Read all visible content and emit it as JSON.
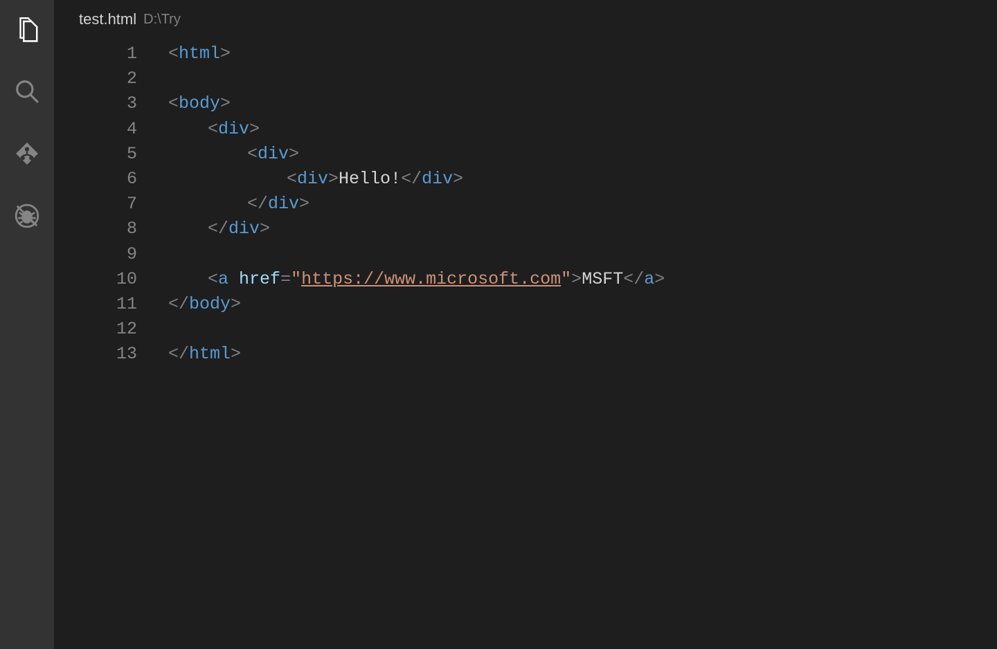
{
  "activityBar": {
    "items": [
      {
        "name": "explorer-icon",
        "active": true
      },
      {
        "name": "search-icon",
        "active": false
      },
      {
        "name": "source-control-icon",
        "active": false
      },
      {
        "name": "debug-icon",
        "active": false
      }
    ]
  },
  "tab": {
    "filename": "test.html",
    "path": "D:\\Try"
  },
  "editor": {
    "lineNumbers": [
      "1",
      "2",
      "3",
      "4",
      "5",
      "6",
      "7",
      "8",
      "9",
      "10",
      "11",
      "12",
      "13"
    ],
    "tokens": {
      "html": "html",
      "body": "body",
      "div": "div",
      "a": "a",
      "href": "href",
      "url": "https://www.microsoft.com",
      "quote": "\"",
      "hello": "Hello!",
      "msft": "MSFT"
    }
  }
}
